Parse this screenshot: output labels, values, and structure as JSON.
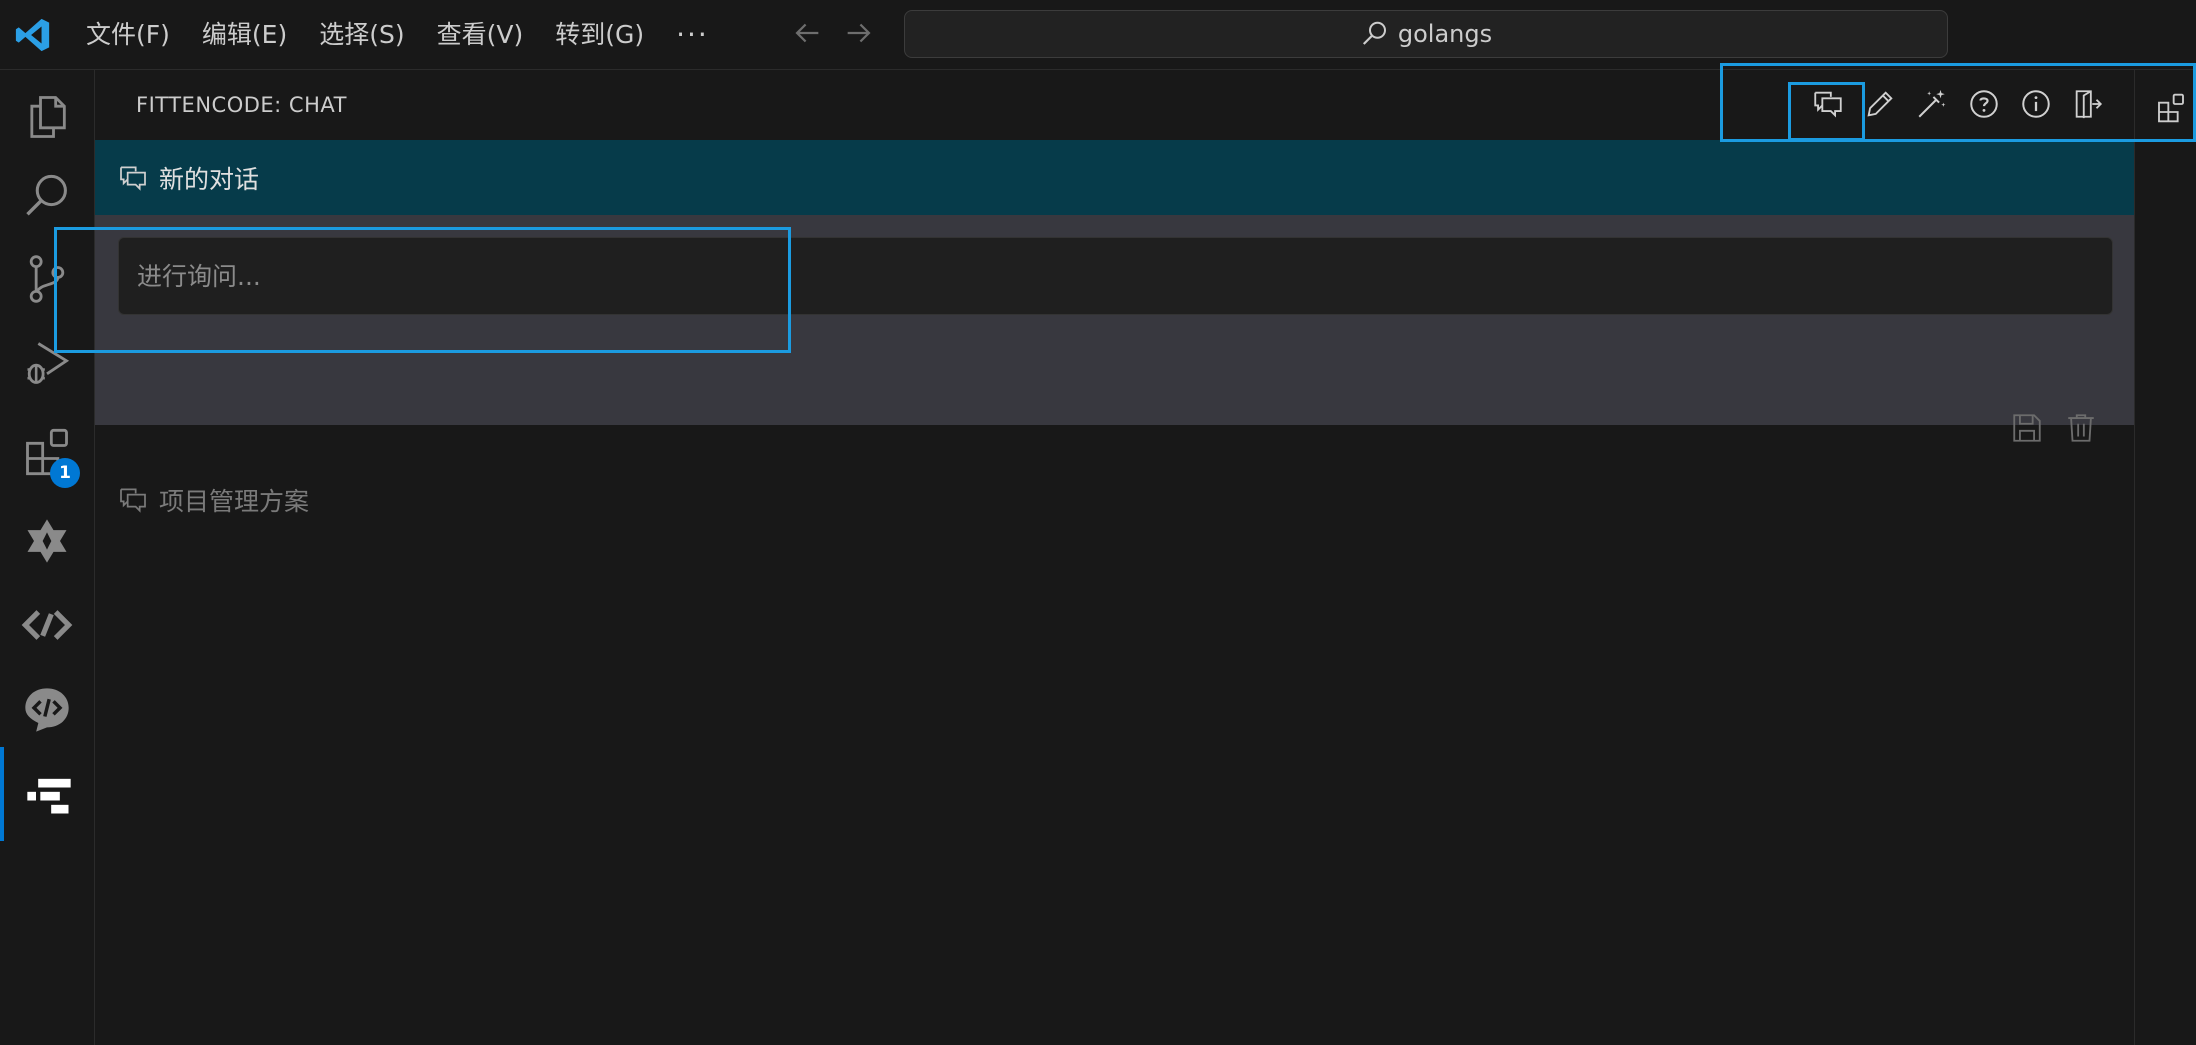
{
  "titlebar": {
    "menu": [
      "文件(F)",
      "编辑(E)",
      "选择(S)",
      "查看(V)",
      "转到(G)"
    ],
    "more": "···",
    "search_text": "golangs"
  },
  "activitybar": {
    "items": [
      "explorer-icon",
      "search-icon",
      "source-control-icon",
      "run-debug-icon",
      "extensions-icon",
      "tongyi-icon",
      "codeium-icon",
      "codegeex-icon",
      "fittencode-icon"
    ],
    "extensions_badge": "1",
    "accent": "#0078d4"
  },
  "panel": {
    "title": "FITTENCODE: CHAT",
    "actions": [
      "new-chat-icon",
      "edit-icon",
      "magic-wand-icon",
      "help-icon",
      "info-icon",
      "logout-icon"
    ],
    "active_conversation": {
      "title": "新的对话",
      "input_placeholder": "进行询问..."
    },
    "conversations": [
      "项目管理方案"
    ]
  },
  "colors": {
    "active_header": "#063b4a",
    "highlight": "#1b9be0"
  }
}
